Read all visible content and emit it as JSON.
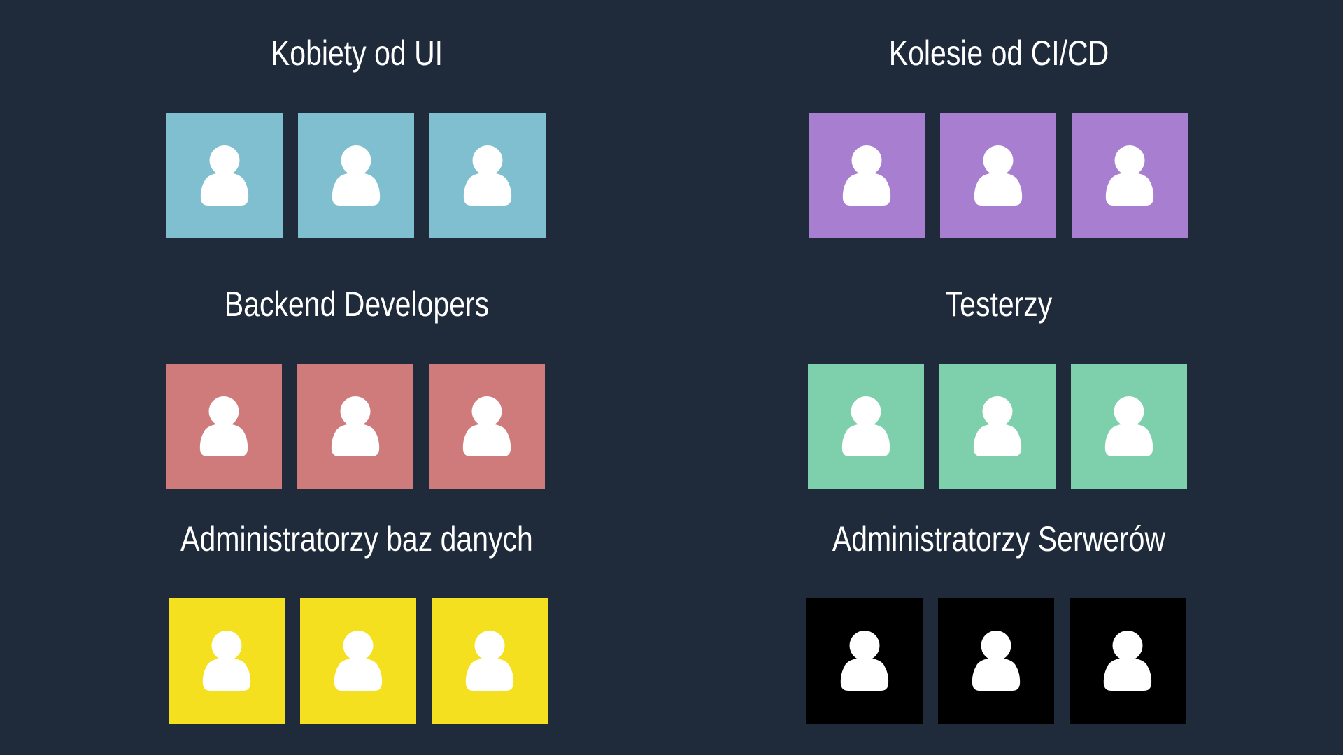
{
  "groups": [
    {
      "title": "Kobiety od UI",
      "color": "#7fbfcf",
      "members": [
        {
          "icon": "person-icon"
        },
        {
          "icon": "person-icon"
        },
        {
          "icon": "person-icon"
        }
      ]
    },
    {
      "title": "Kolesie od CI/CD",
      "color": "#a87ed0",
      "members": [
        {
          "icon": "person-icon"
        },
        {
          "icon": "person-icon"
        },
        {
          "icon": "person-icon"
        }
      ]
    },
    {
      "title": "Backend Developers",
      "color": "#d07b7b",
      "members": [
        {
          "icon": "person-icon"
        },
        {
          "icon": "person-icon"
        },
        {
          "icon": "person-icon"
        }
      ]
    },
    {
      "title": "Testerzy",
      "color": "#7ed0ad",
      "members": [
        {
          "icon": "person-icon"
        },
        {
          "icon": "person-icon"
        },
        {
          "icon": "person-icon"
        }
      ]
    },
    {
      "title": "Administratorzy baz danych",
      "color": "#f5e020",
      "members": [
        {
          "icon": "person-icon"
        },
        {
          "icon": "person-icon"
        },
        {
          "icon": "person-icon"
        }
      ]
    },
    {
      "title": "Administratorzy Serwerów",
      "color": "#000000",
      "members": [
        {
          "icon": "person-icon"
        },
        {
          "icon": "person-icon"
        },
        {
          "icon": "person-icon"
        }
      ]
    }
  ],
  "colors": {
    "background": "#1f2a3a",
    "title_text": "#ffffff",
    "icon": "#ffffff"
  }
}
